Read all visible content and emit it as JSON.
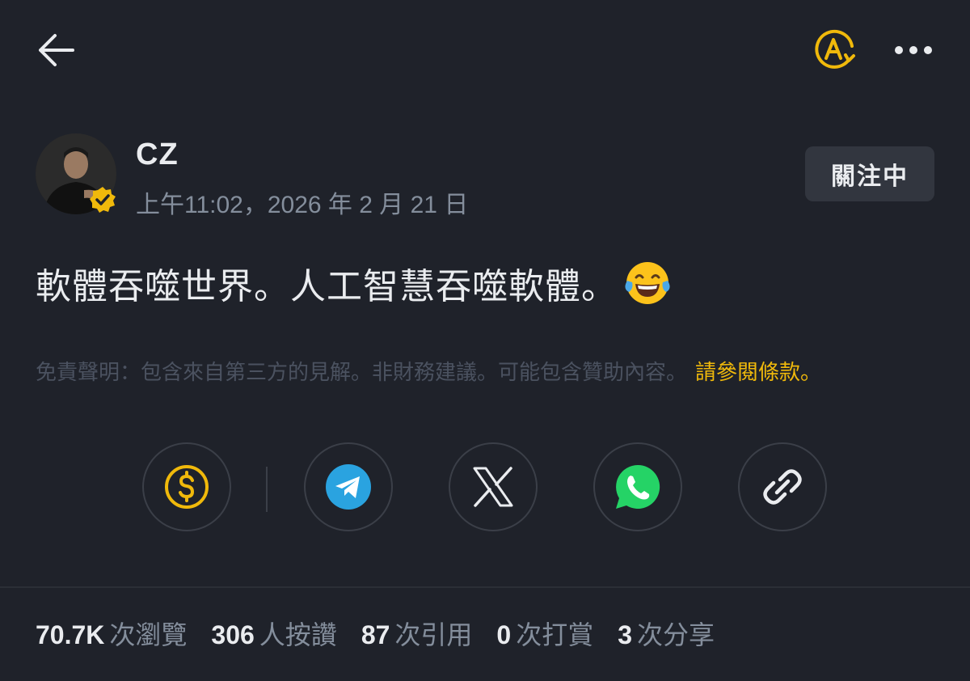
{
  "author": {
    "name": "CZ",
    "timestamp": "上午11:02，2026 年 2 月 21 日",
    "follow_label": "關注中"
  },
  "post": {
    "text": "軟體吞噬世界。人工智慧吞噬軟體。",
    "emoji": "face-with-tears-of-joy"
  },
  "disclaimer": {
    "text": "免責聲明：包含來自第三方的見解。非財務建議。可能包含贊助內容。",
    "link_label": "請參閱條款。"
  },
  "share": {
    "items": [
      "tip-dollar-icon",
      "telegram-icon",
      "x-icon",
      "whatsapp-icon",
      "link-icon"
    ]
  },
  "stats": [
    {
      "value": "70.7K",
      "label": "次瀏覽"
    },
    {
      "value": "306",
      "label": "人按讚"
    },
    {
      "value": "87",
      "label": "次引用"
    },
    {
      "value": "0",
      "label": "次打賞"
    },
    {
      "value": "3",
      "label": "次分享"
    }
  ],
  "colors": {
    "background": "#1f222a",
    "accent": "#f0b90b",
    "text_primary": "#eaecef",
    "text_secondary": "#848e9c",
    "telegram": "#2aa3e0",
    "whatsapp": "#25d366"
  }
}
